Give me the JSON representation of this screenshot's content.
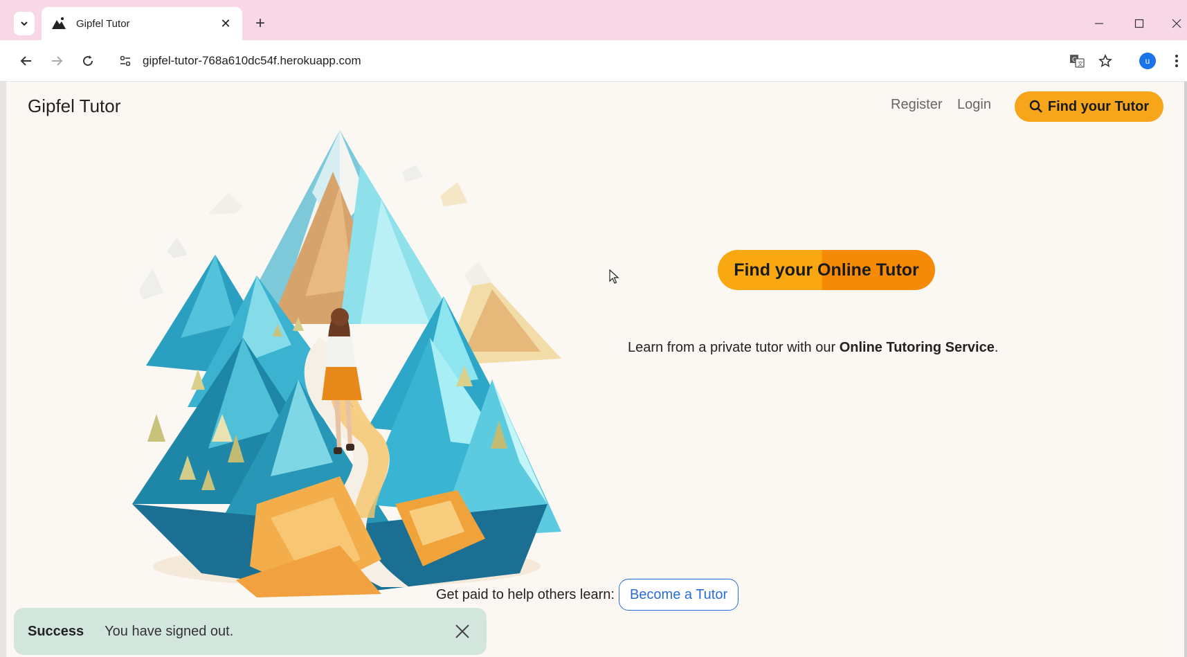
{
  "browser": {
    "tab_title": "Gipfel Tutor",
    "url": "gipfel-tutor-768a610dc54f.herokuapp.com",
    "profile_initial": "u"
  },
  "navbar": {
    "brand": "Gipfel Tutor",
    "register": "Register",
    "login": "Login",
    "find_tutor": "Find your Tutor"
  },
  "hero": {
    "cta": "Find your Online Tutor",
    "tagline_prefix": "Learn from a private tutor with our ",
    "tagline_bold": "Online Tutoring Service",
    "tagline_suffix": "."
  },
  "footer_cta": {
    "label": "Get paid to help others learn:",
    "button": "Become a Tutor"
  },
  "toast": {
    "title": "Success",
    "message": "You have signed out."
  },
  "colors": {
    "accent": "#f7a51a",
    "link": "#2b6cd4",
    "toast_bg": "#d3e6dd",
    "tabstrip": "#f8d7e6"
  }
}
